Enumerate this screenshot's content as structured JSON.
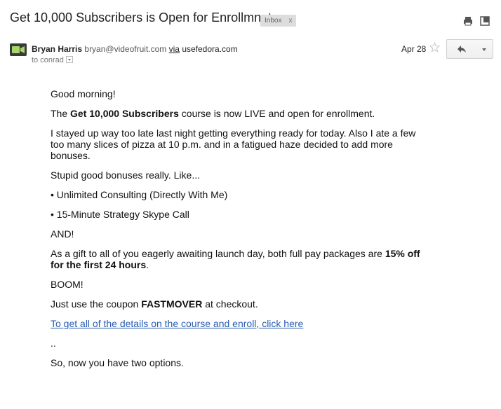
{
  "email": {
    "subject": "Get 10,000 Subscribers is Open for Enrollmnet",
    "label": "Inbox",
    "label_close": "x",
    "sender_name": "Bryan Harris",
    "sender_email": "bryan@videofruit.com",
    "via_word": "via",
    "via_domain": "usefedora.com",
    "to_text": "to conrad",
    "date": "Apr 28"
  },
  "body": {
    "greeting": "Good morning!",
    "p1_pre": "The ",
    "p1_bold": "Get 10,000 Subscribers",
    "p1_post": " course is now LIVE and open for enrollment.",
    "p2": "I stayed up way too late last night getting everything ready for today. Also I ate a few too many slices of pizza at 10 p.m. and in a fatigued haze decided to add more bonuses.",
    "p3": "Stupid good bonuses really. Like...",
    "bullet1": "• Unlimited Consulting (Directly With Me)",
    "bullet2": "• 15-Minute Strategy Skype Call",
    "and": "AND!",
    "p4_pre": "As a gift to all of you eagerly awaiting launch day, both full pay packages are ",
    "p4_bold": "15% off for the first 24 hours",
    "p4_post": ".",
    "boom": "BOOM!",
    "p5_pre": "Just use the coupon ",
    "p5_bold": "FASTMOVER",
    "p5_post": " at checkout.",
    "link": "To get all of the details on the course and enroll, click here",
    "dots": "..",
    "p6": "So, now you have two options."
  },
  "icons": {
    "print": "print-icon",
    "new_window": "new-window-icon",
    "star": "star-icon",
    "reply": "reply-arrow-icon",
    "more": "chevron-down-icon",
    "avatar": "video-camera-icon"
  }
}
